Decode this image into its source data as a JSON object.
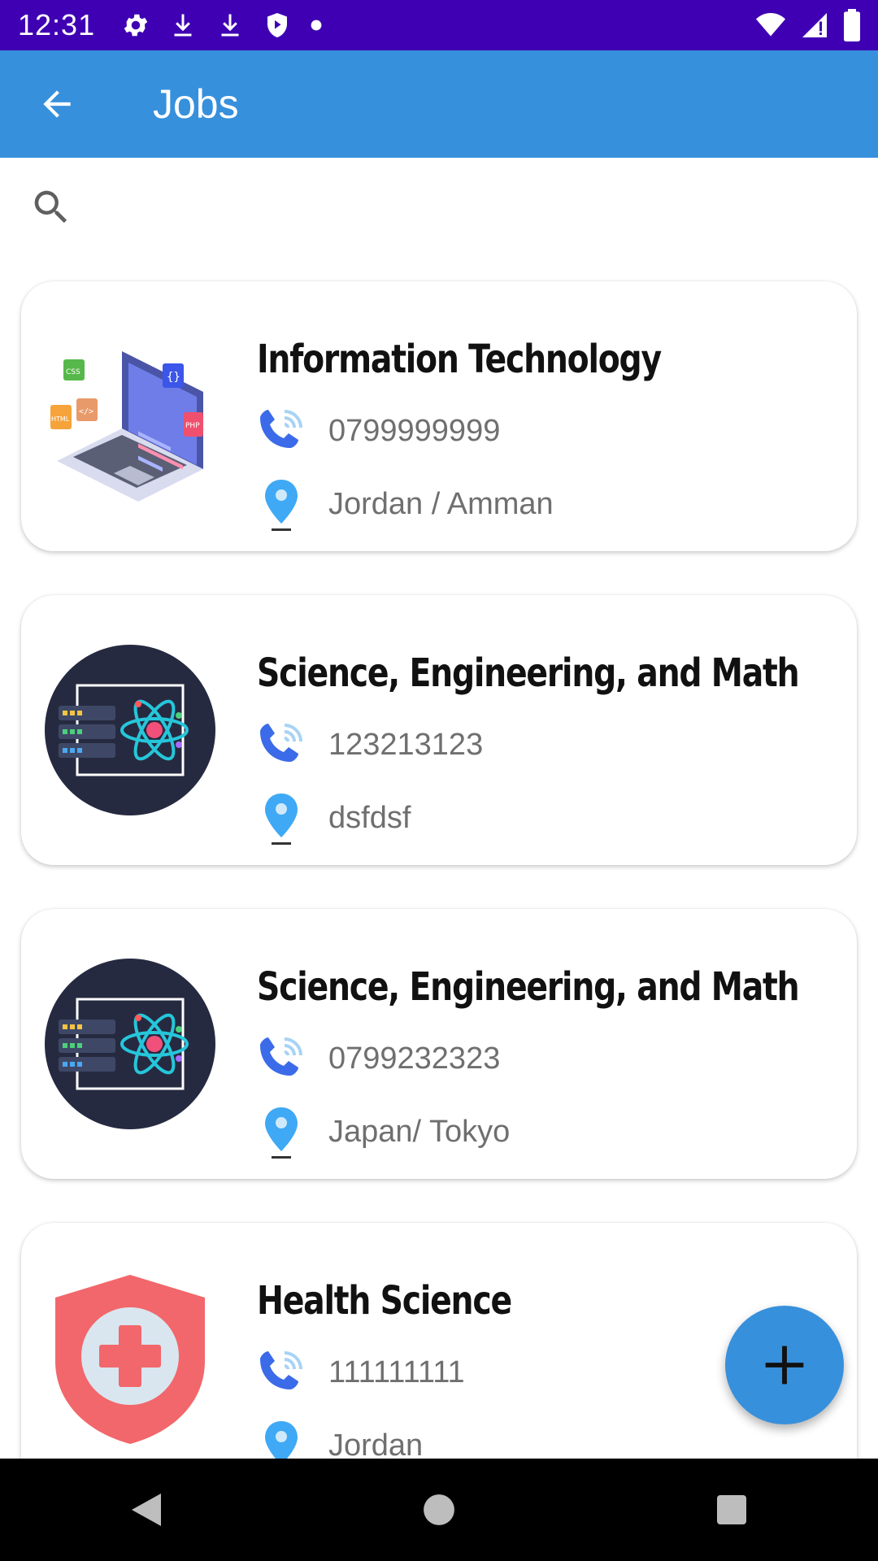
{
  "status_bar": {
    "time": "12:31",
    "left_icons": [
      "settings-icon",
      "download-icon",
      "download-icon",
      "shield-icon",
      "dot-icon"
    ],
    "right_icons": [
      "wifi-icon",
      "signal-icon",
      "battery-icon"
    ]
  },
  "app_bar": {
    "title": "Jobs",
    "back_icon": "arrow-back-icon",
    "color": "#3790dc"
  },
  "search": {
    "placeholder": "",
    "value": "",
    "icon": "search-icon"
  },
  "jobs": [
    {
      "title": "Information Technology",
      "phone": "0799999999",
      "location": "Jordan / Amman",
      "image": "laptop-code-illustration"
    },
    {
      "title": "Science, Engineering, and Math",
      "phone": "123213123",
      "location": "dsfdsf",
      "image": "science-atom-illustration"
    },
    {
      "title": "Science, Engineering, and Math",
      "phone": "0799232323",
      "location": "Japan/ Tokyo",
      "image": "science-atom-illustration"
    },
    {
      "title": "Health Science",
      "phone": "111111111",
      "location": "Jordan",
      "image": "health-shield-illustration"
    }
  ],
  "fab": {
    "icon": "plus-icon",
    "color": "#3790dc"
  },
  "nav_bar": {
    "buttons": [
      "back-triangle-icon",
      "home-circle-icon",
      "recents-square-icon"
    ]
  },
  "colors": {
    "status_bar": "#3f00b3",
    "accent": "#3790dc",
    "phone_icon": "#3b6be8",
    "location_icon": "#3fa9f5"
  }
}
